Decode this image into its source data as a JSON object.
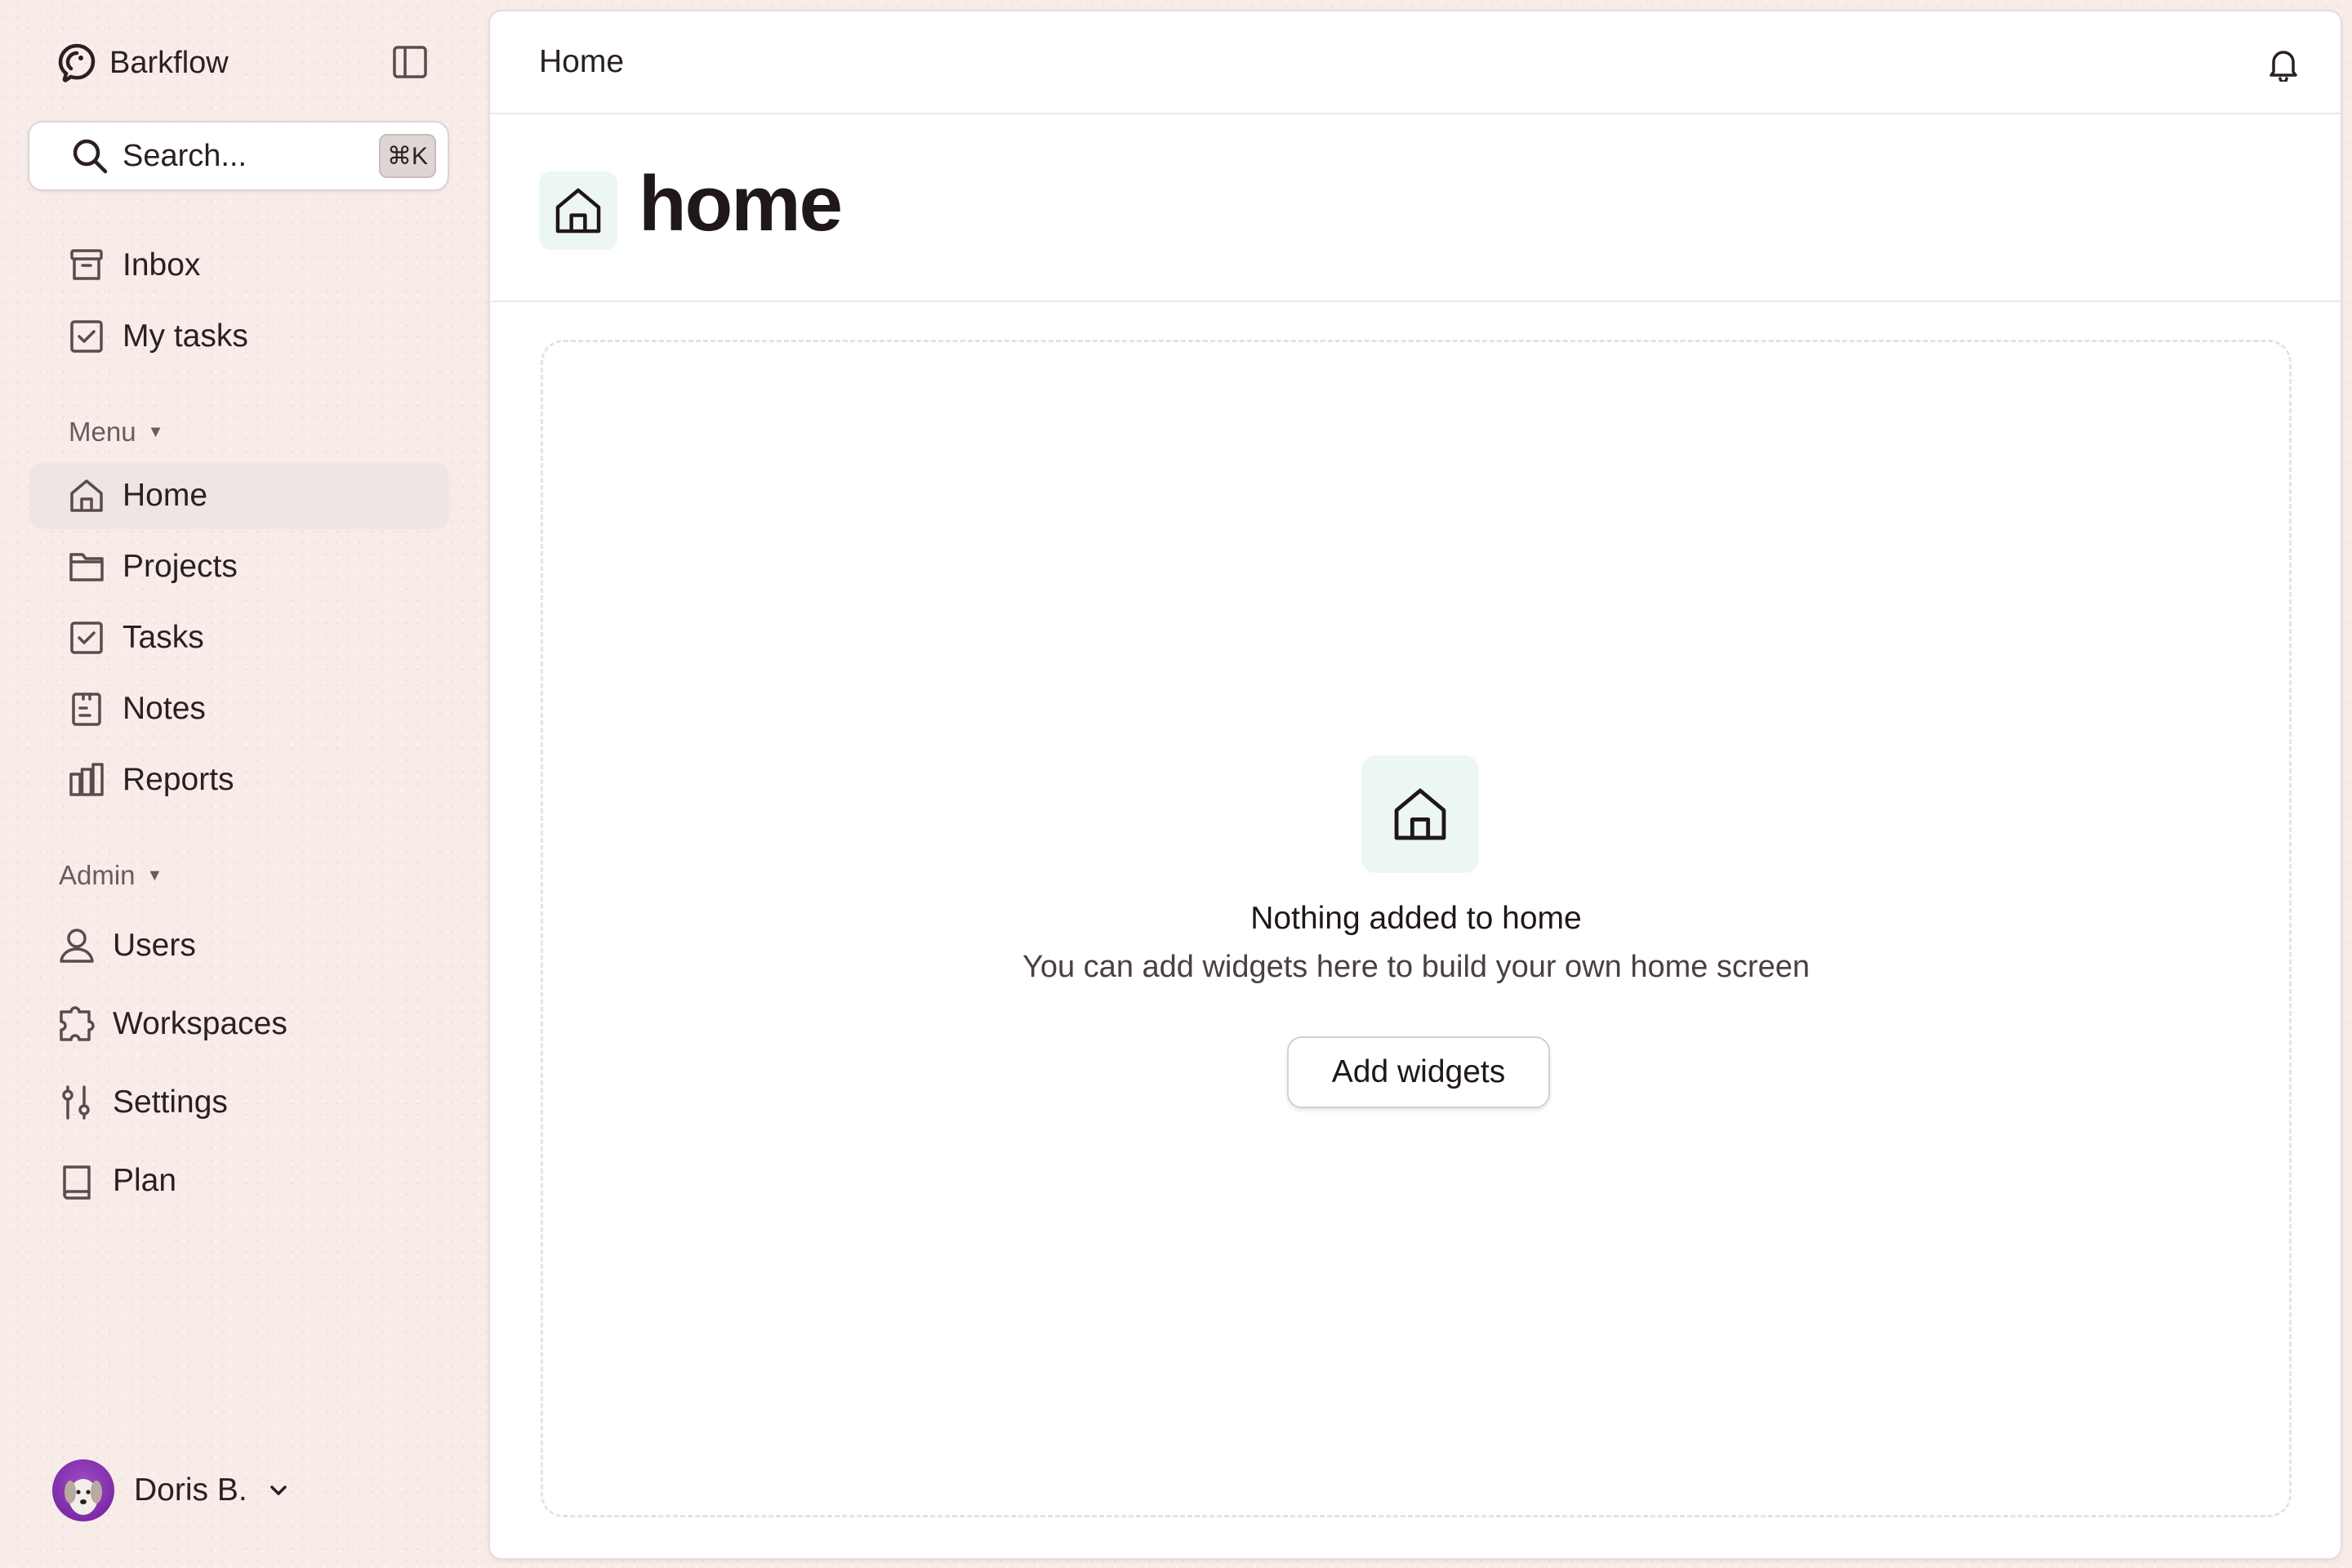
{
  "app": {
    "name": "Barkflow"
  },
  "search": {
    "placeholder": "Search...",
    "shortcut": "⌘K"
  },
  "sidebar": {
    "top_items": [
      {
        "label": "Inbox",
        "icon": "inbox-icon"
      },
      {
        "label": "My tasks",
        "icon": "checkbox-icon"
      }
    ],
    "menu_label": "Menu",
    "menu_items": [
      {
        "label": "Home",
        "icon": "home-icon",
        "active": true
      },
      {
        "label": "Projects",
        "icon": "folder-icon"
      },
      {
        "label": "Tasks",
        "icon": "checkbox-icon"
      },
      {
        "label": "Notes",
        "icon": "notes-icon"
      },
      {
        "label": "Reports",
        "icon": "reports-icon"
      }
    ],
    "admin_label": "Admin",
    "admin_items": [
      {
        "label": "Users",
        "icon": "user-icon"
      },
      {
        "label": "Workspaces",
        "icon": "puzzle-icon"
      },
      {
        "label": "Settings",
        "icon": "sliders-icon"
      },
      {
        "label": "Plan",
        "icon": "book-icon"
      }
    ],
    "user": {
      "name": "Doris B."
    }
  },
  "topbar": {
    "breadcrumb": "Home"
  },
  "page": {
    "title": "home"
  },
  "empty_state": {
    "title": "Nothing added to home",
    "subtitle": "You can add widgets here to build your own home screen",
    "button": "Add widgets"
  },
  "colors": {
    "sidebar_bg": "#f8ece9",
    "active_item_bg": "#efe6e4",
    "icon_tile_bg": "#ecf7f4",
    "text": "#2a2023",
    "avatar_bg": "#8a34b4"
  }
}
